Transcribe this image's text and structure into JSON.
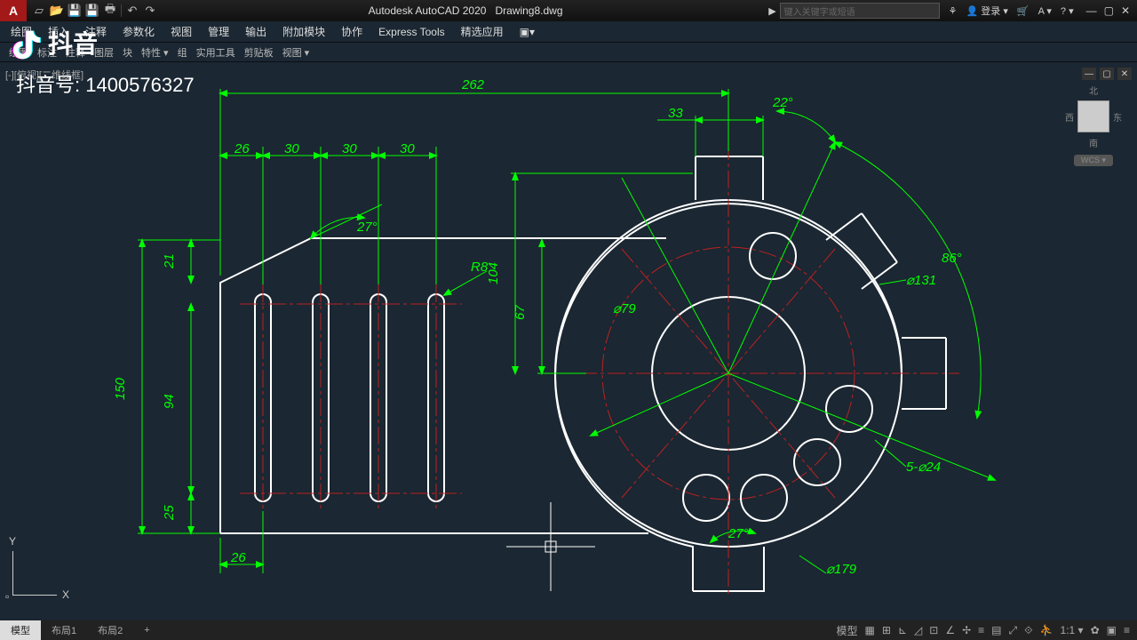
{
  "app": {
    "icon": "A",
    "title": "Autodesk AutoCAD 2020",
    "file": "Drawing8.dwg",
    "search_ph": "键入关键字或短语",
    "login": "登录"
  },
  "menu": [
    "绘图",
    "插入",
    "注释",
    "参数化",
    "视图",
    "管理",
    "输出",
    "附加模块",
    "协作",
    "Express Tools",
    "精选应用"
  ],
  "toolbar": [
    "绘图",
    "标注",
    "注释",
    "图层",
    "块",
    "特性",
    "组",
    "实用工具",
    "剪贴板",
    "视图"
  ],
  "viewport_label": "[-][俯视][二维线框]",
  "viewcube": {
    "n": "北",
    "s": "南",
    "e": "东",
    "w": "西",
    "wcs": "WCS"
  },
  "tabs": [
    "模型",
    "布局1",
    "布局2"
  ],
  "status": {
    "model": "模型",
    "scale": "1:1"
  },
  "watermark": {
    "brand": "抖音",
    "id_label": "抖音号: 1400576327"
  },
  "dims": {
    "d262": "262",
    "d33": "33",
    "d26a": "26",
    "d30a": "30",
    "d30b": "30",
    "d30c": "30",
    "d26b": "26",
    "a22": "22°",
    "a86": "86°",
    "a27": "27°",
    "a27b": "27°",
    "d150": "150",
    "d21": "21",
    "d94": "94",
    "d25": "25",
    "d104": "104",
    "d67": "67",
    "r8": "R8",
    "d79": "⌀79",
    "d131": "⌀131",
    "d179": "⌀179",
    "d524": "5-⌀24"
  },
  "ucs": {
    "x": "X",
    "y": "Y"
  }
}
